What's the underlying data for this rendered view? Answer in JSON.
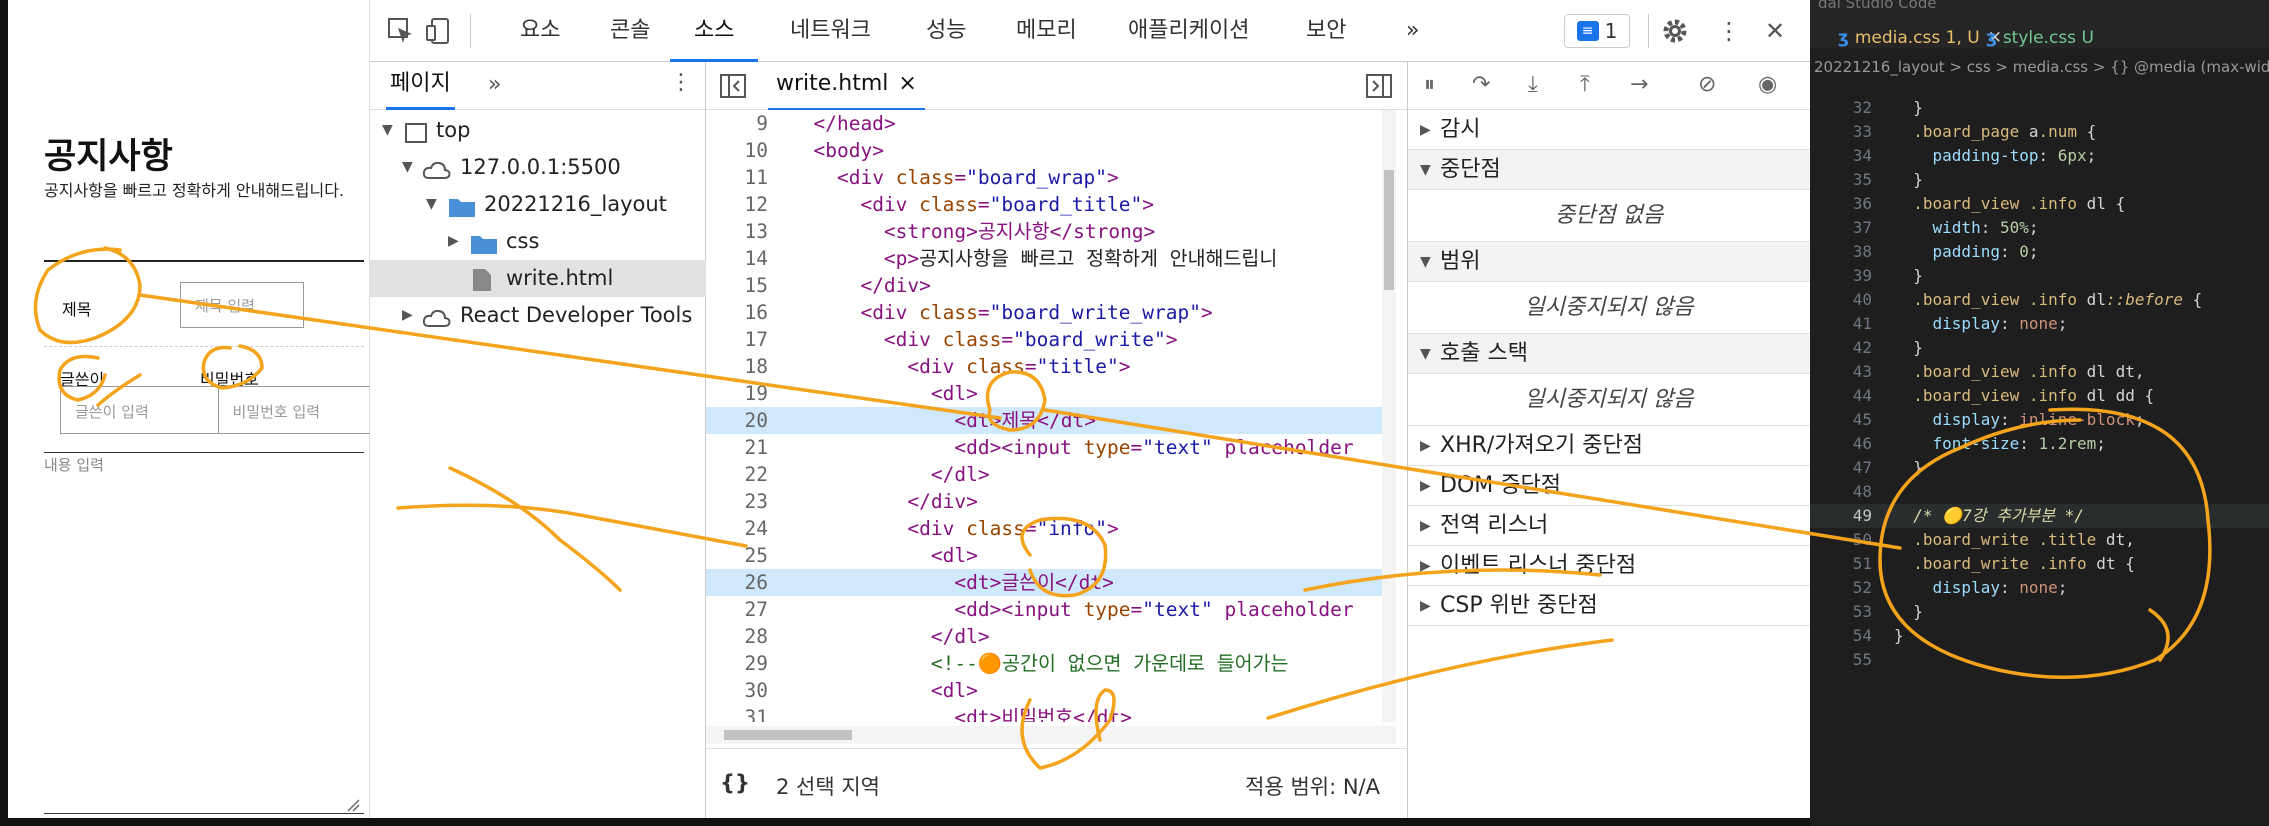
{
  "page": {
    "title": "공지사항",
    "description": "공지사항을 빠르고 정확하게 안내해드립니다.",
    "label_title": "제목",
    "placeholder_title": "제목 입력",
    "label_writer": "글쓴이",
    "label_password": "비밀번호",
    "placeholder_writer": "글쓴이 입력",
    "placeholder_password": "비밀번호 입력",
    "placeholder_content": "내용 입력"
  },
  "devtools": {
    "tabs": [
      "요소",
      "콘솔",
      "소스",
      "네트워크",
      "성능",
      "메모리",
      "애플리케이션",
      "보안"
    ],
    "active_tab": "소스",
    "more": "»",
    "issues_count": "1",
    "navigator": {
      "tab": "페이지",
      "more": "»",
      "tree": [
        {
          "label": "top"
        },
        {
          "label": "127.0.0.1:5500"
        },
        {
          "label": "20221216_layout"
        },
        {
          "label": "css"
        },
        {
          "label": "write.html"
        },
        {
          "label": "React Developer Tools"
        }
      ]
    },
    "editor": {
      "file_tab": "write.html",
      "close": "×",
      "lines": [
        {
          "n": "9",
          "t": "  </head>"
        },
        {
          "n": "10",
          "t": "  <body>"
        },
        {
          "n": "11",
          "t": "    <div class=\"board_wrap\">"
        },
        {
          "n": "12",
          "t": "      <div class=\"board_title\">"
        },
        {
          "n": "13",
          "t": "        <strong>공지사항</strong>"
        },
        {
          "n": "14",
          "t": "        <p>공지사항을 빠르고 정확하게 안내해드립니"
        },
        {
          "n": "15",
          "t": "      </div>"
        },
        {
          "n": "16",
          "t": "      <div class=\"board_write_wrap\">"
        },
        {
          "n": "17",
          "t": "        <div class=\"board_write\">"
        },
        {
          "n": "18",
          "t": "          <div class=\"title\">"
        },
        {
          "n": "19",
          "t": "            <dl>"
        },
        {
          "n": "20",
          "t": "              <dt>제목</dt>"
        },
        {
          "n": "21",
          "t": "              <dd><input type=\"text\" placeholder"
        },
        {
          "n": "22",
          "t": "            </dl>"
        },
        {
          "n": "23",
          "t": "          </div>"
        },
        {
          "n": "24",
          "t": "          <div class=\"info\">"
        },
        {
          "n": "25",
          "t": "            <dl>"
        },
        {
          "n": "26",
          "t": "              <dt>글쓴이</dt>"
        },
        {
          "n": "27",
          "t": "              <dd><input type=\"text\" placeholder"
        },
        {
          "n": "28",
          "t": "            </dl>"
        },
        {
          "n": "29",
          "t": "            <!--🟠공간이 없으면 가운데로 들어가는"
        },
        {
          "n": "30",
          "t": "            <dl>"
        },
        {
          "n": "31",
          "t": "              <dt>비밀번호</dt>"
        }
      ],
      "footer_brackets": "{}",
      "footer_selection": "2 선택 지역",
      "footer_coverage": "적용 범위: N/A"
    },
    "debugger": {
      "sections": [
        {
          "label": "감시",
          "open": false
        },
        {
          "label": "중단점",
          "open": true,
          "message": "중단점 없음"
        },
        {
          "label": "범위",
          "open": true,
          "message": "일시중지되지 않음"
        },
        {
          "label": "호출 스택",
          "open": true,
          "message": "일시중지되지 않음"
        },
        {
          "label": "XHR/가져오기 중단점",
          "open": false
        },
        {
          "label": "DOM 중단점",
          "open": false
        },
        {
          "label": "전역 리스너",
          "open": false
        },
        {
          "label": "이벤트 리스너 중단점",
          "open": false
        },
        {
          "label": "CSP 위반 중단점",
          "open": false
        }
      ]
    }
  },
  "vscode": {
    "title_fragment": "dal Studio Code",
    "tabs": [
      {
        "label": "media.css 1, U",
        "active": true
      },
      {
        "label": "style.css U",
        "active": false
      }
    ],
    "breadcrumb": "20221216_layout  >  css  >  media.css  >  {} @media (max-wid",
    "lines": [
      {
        "n": "32",
        "t": "  }"
      },
      {
        "n": "33",
        "t": "  .board_page a.num {"
      },
      {
        "n": "34",
        "t": "    padding-top: 6px;"
      },
      {
        "n": "35",
        "t": "  }"
      },
      {
        "n": "36",
        "t": "  .board_view .info dl {"
      },
      {
        "n": "37",
        "t": "    width: 50%;"
      },
      {
        "n": "38",
        "t": "    padding: 0;"
      },
      {
        "n": "39",
        "t": "  }"
      },
      {
        "n": "40",
        "t": "  .board_view .info dl::before {"
      },
      {
        "n": "41",
        "t": "    display: none;"
      },
      {
        "n": "42",
        "t": "  }"
      },
      {
        "n": "43",
        "t": "  .board_view .info dl dt,"
      },
      {
        "n": "44",
        "t": "  .board_view .info dl dd {"
      },
      {
        "n": "45",
        "t": "    display: inline-block;"
      },
      {
        "n": "46",
        "t": "    font-size: 1.2rem;"
      },
      {
        "n": "47",
        "t": "  }"
      },
      {
        "n": "48",
        "t": ""
      },
      {
        "n": "49",
        "t": "  /* 🟡7강 추가부분 */"
      },
      {
        "n": "50",
        "t": "  .board_write .title dt,"
      },
      {
        "n": "51",
        "t": "  .board_write .info dt {"
      },
      {
        "n": "52",
        "t": "    display: none;"
      },
      {
        "n": "53",
        "t": "  }"
      },
      {
        "n": "54",
        "t": "}"
      },
      {
        "n": "55",
        "t": ""
      }
    ]
  },
  "colors": {
    "accent": "#1a73e8",
    "ink": "#f4a31c",
    "highlight": "#cfe8fc"
  }
}
